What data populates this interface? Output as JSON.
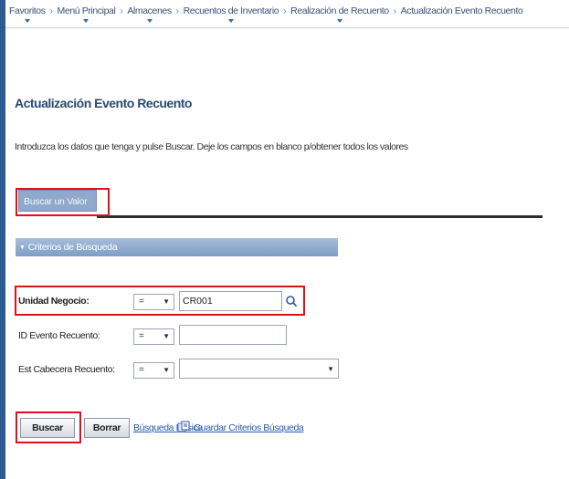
{
  "breadcrumb": [
    {
      "label": "Favoritos",
      "has_menu": true
    },
    {
      "label": "Menú Principal",
      "has_menu": true
    },
    {
      "label": "Almacenes",
      "has_menu": true
    },
    {
      "label": "Recuentos de Inventario",
      "has_menu": true
    },
    {
      "label": "Realización de Recuento",
      "has_menu": true
    },
    {
      "label": "Actualización Evento Recuento",
      "has_menu": false
    }
  ],
  "breadcrumb_separator": "›",
  "page": {
    "title": "Actualización Evento Recuento",
    "instructions": "Introduzca los datos que tenga y pulse Buscar. Deje los campos en blanco p/obtener todos los valores"
  },
  "tab": {
    "label": "Buscar un Valor"
  },
  "section": {
    "title": "Criterios de Búsqueda",
    "expanded": true
  },
  "fields": {
    "unidad_negocio": {
      "label": "Unidad Negocio:",
      "operator": "=",
      "value": "CR001"
    },
    "id_evento": {
      "label": "ID Evento Recuento:",
      "operator": "=",
      "value": ""
    },
    "est_cabecera": {
      "label": "Est Cabecera Recuento:",
      "operator": "=",
      "value": ""
    }
  },
  "actions": {
    "search": "Buscar",
    "clear": "Borrar",
    "basic_search": "Búsqueda Básica",
    "save_criteria": "Guardar Criterios Búsqueda"
  },
  "colors": {
    "highlight": "#e0101a",
    "section_bg": "#8ea9cb",
    "link": "#2a59b0"
  }
}
